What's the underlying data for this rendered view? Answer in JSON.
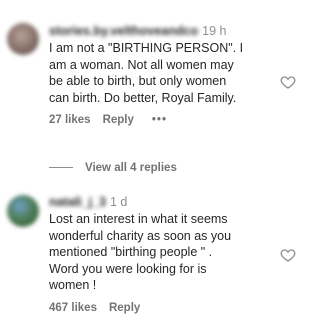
{
  "comments": [
    {
      "username": "stories.by.velthoveandco",
      "time": "19 h",
      "lines": [
        "I am not a \"BIRTHING PERSON\". I",
        "am a woman. Not all women may",
        "be able to birth, but only women",
        "can birth. Do better, Royal Family."
      ],
      "likes": "27 likes",
      "reply_label": "Reply",
      "more_label": "•••"
    },
    {
      "username": "natali_j_3",
      "time": "1 d",
      "lines": [
        "Lost an interest in what it seems",
        "wonderful charity as soon as you",
        "mentioned \"birthing people \" .",
        "Word you were looking for is",
        "women !"
      ],
      "likes": "467 likes",
      "reply_label": "Reply"
    }
  ],
  "view_replies": "View all 4 replies",
  "icons": {
    "heart": "heart-outline-icon"
  }
}
